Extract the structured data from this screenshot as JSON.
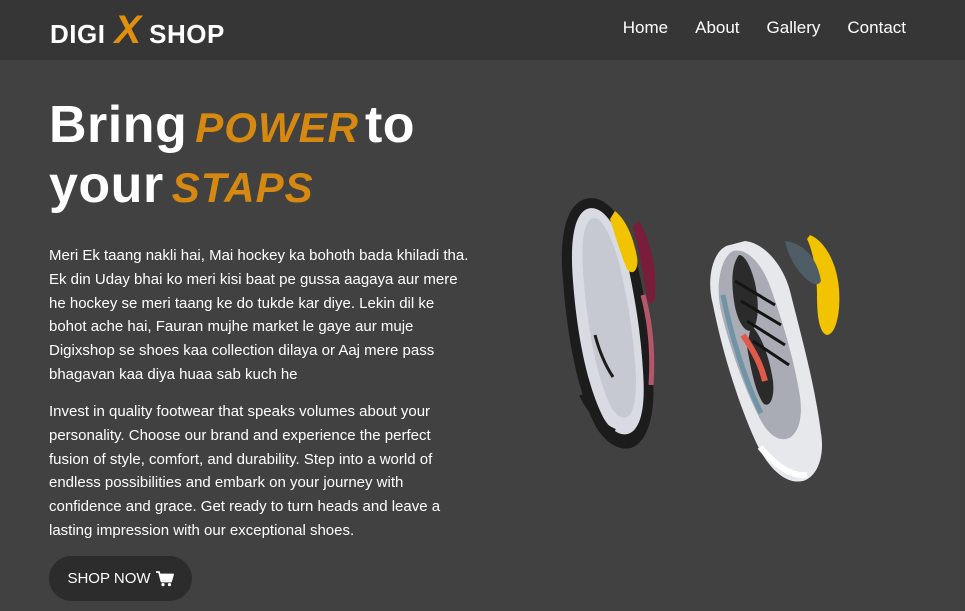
{
  "brand": {
    "part1": "DIGI",
    "mark": "X",
    "part2": "SHOP"
  },
  "nav": [
    {
      "label": "Home"
    },
    {
      "label": "About"
    },
    {
      "label": "Gallery"
    },
    {
      "label": "Contact"
    }
  ],
  "hero": {
    "line1_start": "Bring",
    "line1_accent": "POWER",
    "line1_end": "to",
    "line2_start": "your",
    "line2_accent": "STAPS",
    "paragraph1": "Meri Ek taang nakli hai, Mai hockey ka bohoth bada khiladi tha. Ek din Uday bhai ko meri kisi baat pe gussa aagaya aur mere he hockey se meri taang ke do tukde kar diye. Lekin dil ke bohot ache hai, Fauran mujhe market le gaye aur muje Digixshop se shoes kaa collection dilaya or Aaj mere pass bhagavan kaa diya huaa sab kuch he",
    "paragraph2": "Invest in quality footwear that speaks volumes about your personality. Choose our brand and experience the perfect fusion of style, comfort, and durability. Step into a world of endless possibilities and embark on your journey with confidence and grace. Get ready to turn heads and leave a lasting impression with our exceptional shoes.",
    "cta_label": "SHOP NOW",
    "cta_icon": "shopping-cart-icon"
  },
  "image": {
    "name": "sneakers-pair-image"
  },
  "colors": {
    "background": "#414141",
    "navbar": "#363636",
    "accent": "#d68910",
    "button": "#2c2c2c",
    "text": "#ffffff"
  }
}
